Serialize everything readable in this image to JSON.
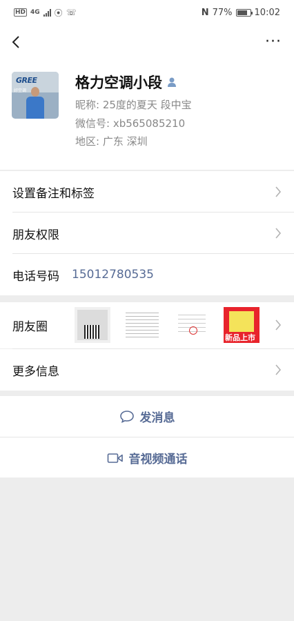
{
  "status_bar": {
    "left_badge": "HD",
    "network": "4G",
    "battery_percent": "77%",
    "time": "10:02"
  },
  "header": {
    "back_icon": "chevron-left-icon",
    "more_icon": "more-dots-icon",
    "more_label": "···"
  },
  "profile": {
    "avatar_logo_text": "GREE",
    "avatar_tagline": "好空调",
    "name": "格力空调小段",
    "nickname": "昵称: 25度的夏天 段中宝",
    "wechat_id": "微信号: xb565085210",
    "region": "地区: 广东  深圳"
  },
  "rows": {
    "remark_label": "设置备注和标签",
    "permission_label": "朋友权限",
    "phone_label": "电话号码",
    "phone_value": "15012780535",
    "moments_label": "朋友圈",
    "more_info_label": "更多信息"
  },
  "moments_thumbs": {
    "thumb4_text": "新品上市"
  },
  "actions": {
    "message_label": "发消息",
    "video_call_label": "音视频通话"
  },
  "colors": {
    "link": "#576b95",
    "background": "#ededed"
  }
}
